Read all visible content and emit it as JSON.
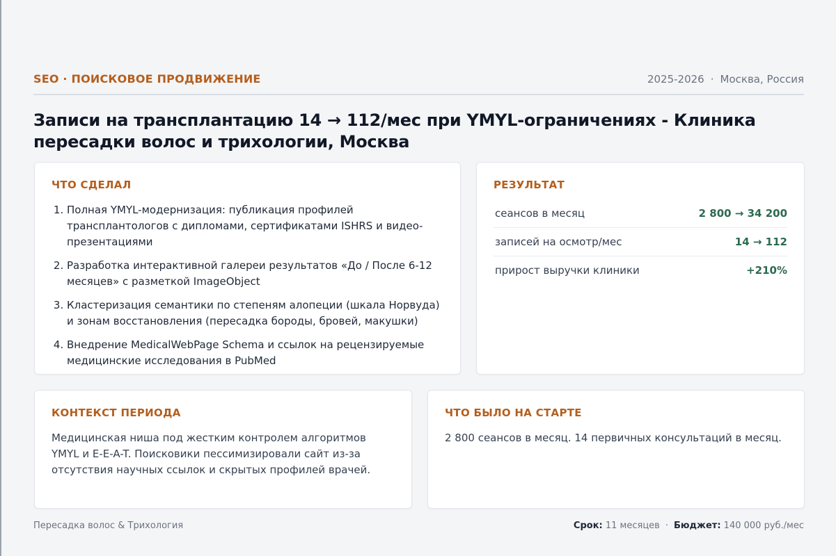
{
  "header": {
    "category": "SEO · ПОИСКОВОЕ ПРОДВИЖЕНИЕ",
    "years": "2025-2026",
    "separator": "·",
    "location": "Москва, Россия"
  },
  "title": "Записи на трансплантацию 14 → 112/мес при YMYL-ограничениях - Клиника пересадки волос и трихологии, Москва",
  "did": {
    "title": "ЧТО СДЕЛАЛ",
    "items": [
      "Полная YMYL-модернизация: публикация профилей трансплантологов с дипломами, сертификатами ISHRS и видео-презентациями",
      "Разработка интерактивной галереи результатов «До / После 6-12 месяцев» с разметкой ImageObject",
      "Кластеризация семантики по степеням алопеции (шкала Норвуда) и зонам восстановления (пересадка бороды, бровей, макушки)",
      "Внедрение MedicalWebPage Schema и ссылок на рецензируемые медицинские исследования в PubMed"
    ]
  },
  "result": {
    "title": "РЕЗУЛЬТАТ",
    "metrics": [
      {
        "label": "сеансов в месяц",
        "value": "2 800 → 34 200"
      },
      {
        "label": "записей на осмотр/мес",
        "value": "14 → 112"
      },
      {
        "label": "прирост выручки клиники",
        "value": "+210%"
      }
    ]
  },
  "context": {
    "title": "КОНТЕКСТ ПЕРИОДА",
    "text": "Медицинская ниша под жестким контролем алгоритмов YMYL и E-E-A-T. Поисковики пессимизировали сайт из-за отсутствия научных ссылок и скрытых профилей врачей."
  },
  "start": {
    "title": "ЧТО БЫЛО НА СТАРТЕ",
    "text": "2 800 сеансов в месяц. 14 первичных консультаций в месяц."
  },
  "footer": {
    "niche": "Пересадка волос & Трихология",
    "term_label": "Срок:",
    "term_value": "11 месяцев",
    "separator": "·",
    "budget_label": "Бюджет:",
    "budget_value": "140 000 руб./мес"
  },
  "colors": {
    "accent": "#b45f1e",
    "positive": "#2c6a4f",
    "background": "#f4f5f7"
  }
}
